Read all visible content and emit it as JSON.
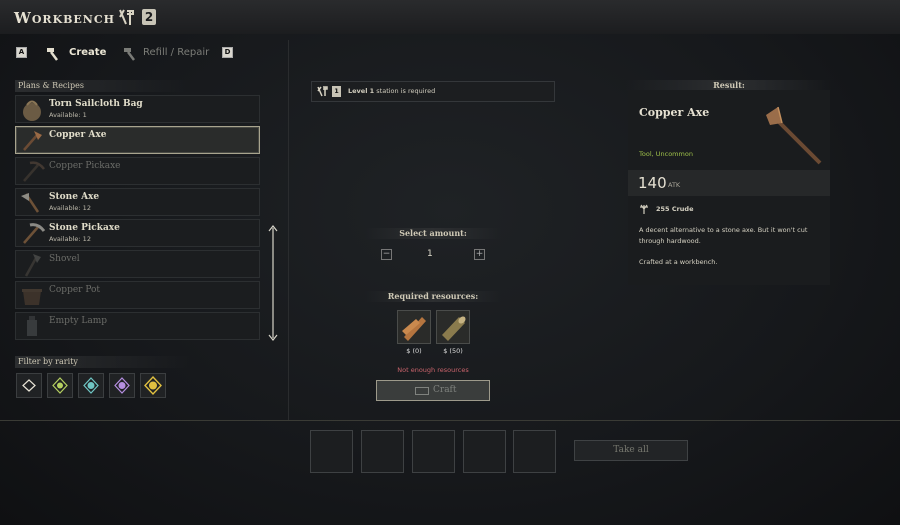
{
  "header": {
    "title": "Workbench",
    "level": "2"
  },
  "tabs": [
    {
      "key": "A",
      "label": "Create"
    },
    {
      "label": "Refill / Repair",
      "key": "D"
    }
  ],
  "plans": {
    "heading": "Plans & Recipes",
    "items": [
      {
        "name": "Torn Sailcloth Bag",
        "available": "Available: 1"
      },
      {
        "name": "Copper Axe",
        "available": ""
      },
      {
        "name": "Copper Pickaxe",
        "available": ""
      },
      {
        "name": "Stone Axe",
        "available": "Available: 12"
      },
      {
        "name": "Stone Pickaxe",
        "available": "Available: 12"
      },
      {
        "name": "Shovel",
        "available": ""
      },
      {
        "name": "Copper Pot",
        "available": ""
      },
      {
        "name": "Empty Lamp",
        "available": ""
      }
    ]
  },
  "filter": {
    "heading": "Filter by rarity"
  },
  "requirement": {
    "level_bold": "Level 1",
    "text": " station is required",
    "level": "1"
  },
  "amount": {
    "heading": "Select amount:",
    "value": "1",
    "minus": "−",
    "plus": "+"
  },
  "resources": {
    "heading": "Required resources:",
    "items": [
      {
        "value": "$ (0)"
      },
      {
        "value": "$ (50)"
      }
    ],
    "warning": "Not enough resources"
  },
  "craft_label": "Craft",
  "take_all_label": "Take all",
  "result": {
    "heading": "Result:",
    "name": "Copper Axe",
    "type": "Tool, Uncommon",
    "atk_value": "140",
    "atk_label": "ATK",
    "cost": "255 Crude",
    "description": "A decent alternative to a stone axe. But it won't cut through hardwood.",
    "crafted": "Crafted at a workbench."
  },
  "colors": {
    "uncommon": "#9ec04a",
    "warning": "#c9636b",
    "accent": "#e6e1d2"
  }
}
